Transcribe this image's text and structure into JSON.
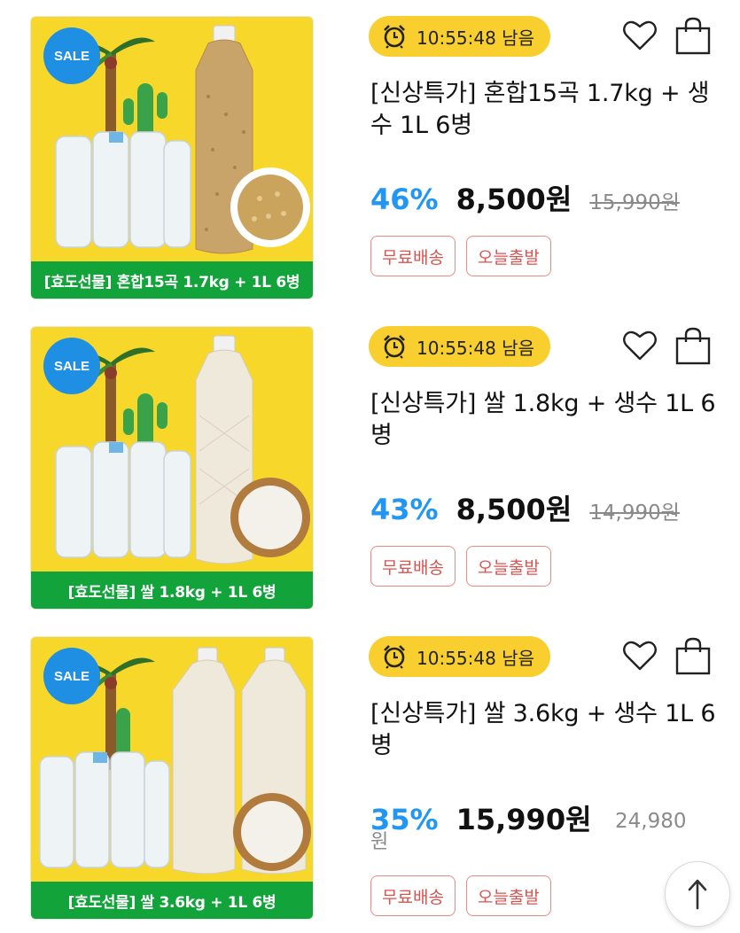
{
  "products": [
    {
      "banner": "[효도선물] 혼합15곡 1.7kg + 1L 6병",
      "sale_badge": "SALE",
      "timer": "10:55:48 남음",
      "title": "[신상특가] 혼합15곡 1.7kg + 생수 1L 6병",
      "discount": "46%",
      "price": "8,500원",
      "original_price": "15,990원",
      "tags": [
        "무료배송",
        "오늘출발"
      ]
    },
    {
      "banner": "[효도선물] 쌀 1.8kg + 1L 6병",
      "sale_badge": "SALE",
      "timer": "10:55:48 남음",
      "title": "[신상특가] 쌀 1.8kg + 생수 1L 6병",
      "discount": "43%",
      "price": "8,500원",
      "original_price": "14,990원",
      "tags": [
        "무료배송",
        "오늘출발"
      ]
    },
    {
      "banner": "[효도선물] 쌀 3.6kg + 1L 6병",
      "sale_badge": "SALE",
      "timer": "10:55:48 남음",
      "title": "[신상특가] 쌀 3.6kg + 생수 1L 6병",
      "discount": "35%",
      "price": "15,990원",
      "original_price_line1": "24,980",
      "original_price_line2": "원",
      "tags": [
        "무료배송",
        "오늘출발"
      ]
    }
  ],
  "icons": {
    "timer": "alarm-clock-icon",
    "wishlist": "heart-icon",
    "cart": "shopping-bag-icon",
    "scroll_top": "arrow-up-icon"
  },
  "colors": {
    "thumb_background": "#f7d82a",
    "banner_green": "#12a33a",
    "sale_blue": "#1e8fe3",
    "timer_yellow": "#f9cf2f",
    "discount_blue": "#2196f3",
    "tag_red": "#d9534f"
  }
}
